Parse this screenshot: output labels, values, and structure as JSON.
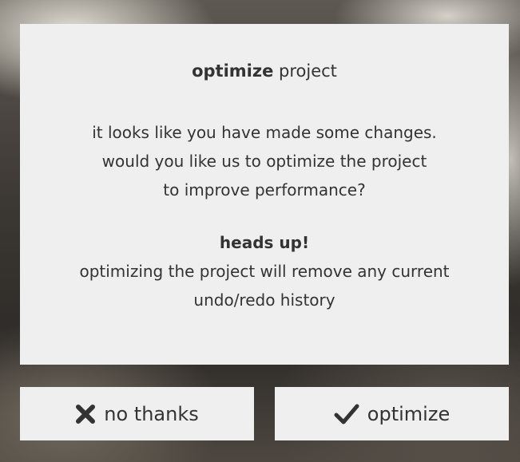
{
  "dialog": {
    "title_strong": "optimize",
    "title_rest": " project",
    "message_lines": [
      "it looks like you have made some changes.",
      "would you like us to optimize the project",
      "to improve performance?"
    ],
    "heads_up": "heads up!",
    "warning_lines": [
      "optimizing the project will remove any current",
      "undo/redo history"
    ]
  },
  "buttons": {
    "no_thanks": {
      "label": "no thanks",
      "icon": "x-icon"
    },
    "optimize": {
      "label": "optimize",
      "icon": "checkmark-icon"
    }
  },
  "colors": {
    "dialog_background": "#efefef",
    "text": "#333333"
  }
}
